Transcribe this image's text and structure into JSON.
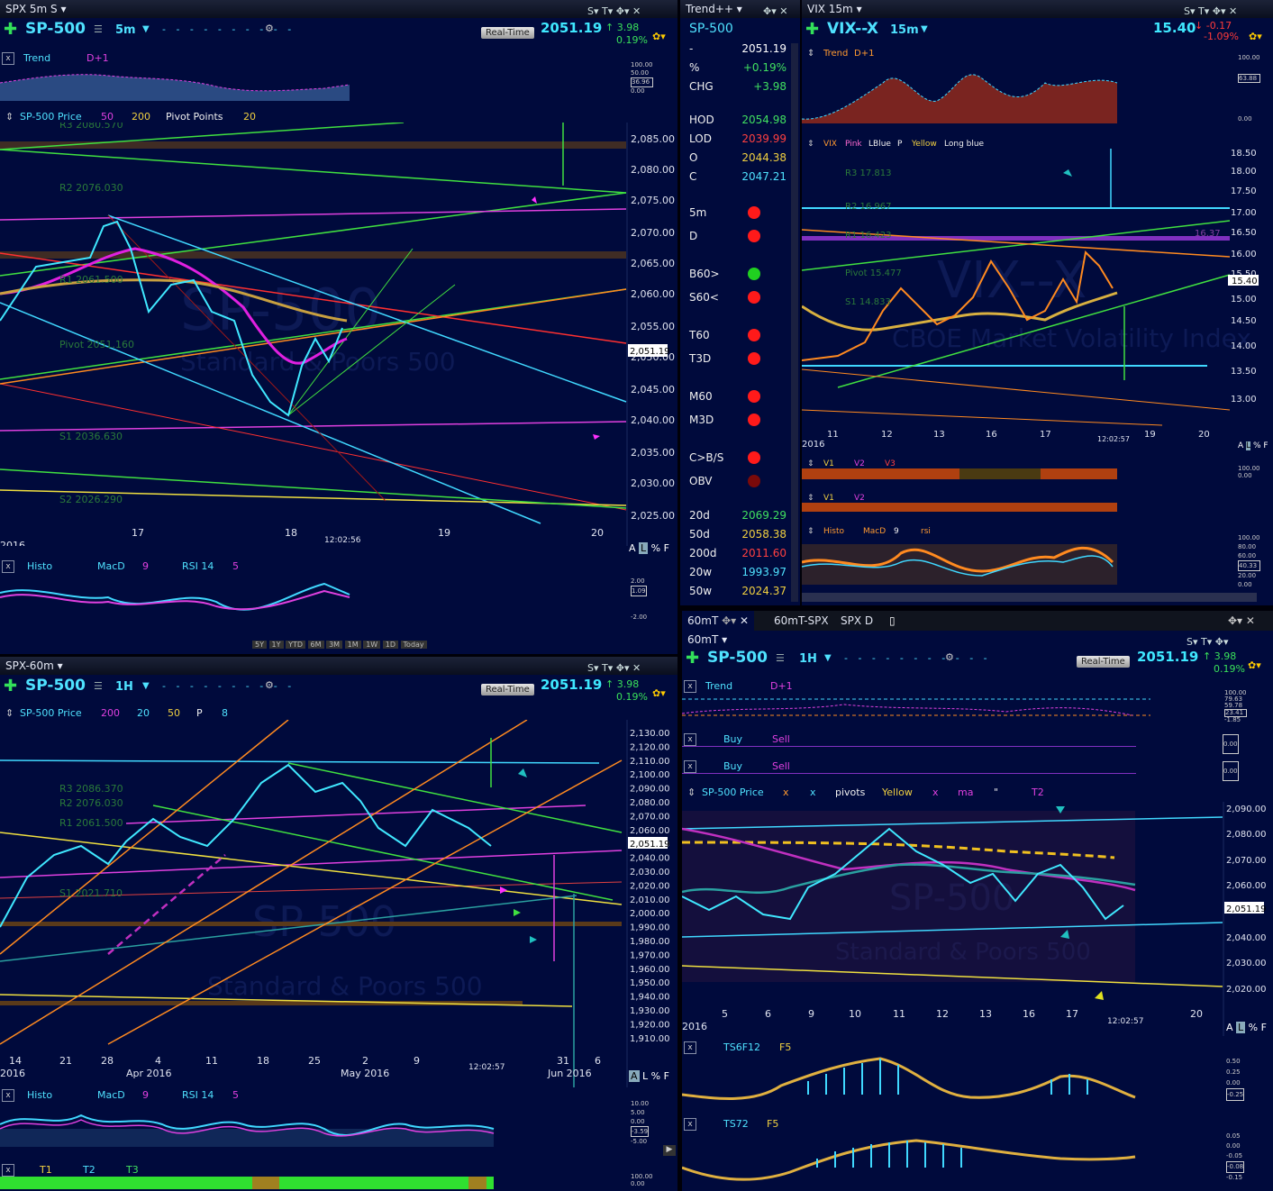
{
  "top_left": {
    "window_title": "SPX 5m S",
    "symbol": "SP-500",
    "timeframe": "5m",
    "realtime": "Real-Time",
    "last": "2051.19",
    "change": "3.98",
    "change_pct": "0.19%",
    "trend_label": "Trend",
    "trend_param": "D+1",
    "trend_scale": [
      "100.00",
      "50.00",
      "36.96",
      "0.00"
    ],
    "price_label": "SP-500 Price",
    "price_p1": "50",
    "price_p2": "200",
    "pivot_label": "Pivot Points",
    "pivot_p": "20",
    "price_axis": [
      "2,085.00",
      "2,080.00",
      "2,075.00",
      "2,070.00",
      "2,065.00",
      "2,060.00",
      "2,055.00",
      "2,050.00",
      "2,045.00",
      "2,040.00",
      "2,035.00",
      "2,030.00",
      "2,025.00"
    ],
    "last_tag": "2,051.19",
    "pivot_levels": [
      "R3 2080.570",
      "R2 2076.030",
      "R1 2061.500",
      "Pivot 2051.160",
      "S1 2036.630",
      "S2 2026.290"
    ],
    "x_labels": [
      "17",
      "18",
      "19",
      "20"
    ],
    "year": "2016",
    "time": "12:02:56",
    "axis_modes": [
      "A",
      "L",
      "%",
      "F"
    ],
    "watermark1": "SP-500",
    "watermark2": "Standard & Poors 500",
    "osc_label": "Histo",
    "osc_macd": "MacD",
    "osc_p1": "9",
    "osc_rsi": "RSI 14",
    "osc_p2": "5",
    "osc_scale": [
      "2.00",
      "1.09",
      "-2.00"
    ],
    "ranges": [
      "5Y",
      "1Y",
      "YTD",
      "6M",
      "3M",
      "1M",
      "1W",
      "1D",
      "Today"
    ]
  },
  "trend_panel": {
    "title": "Trend++",
    "symbol": "SP-500",
    "rows": [
      {
        "k": "-",
        "v": "2051.19",
        "c": "#ffffff"
      },
      {
        "k": "%",
        "v": "+0.19%",
        "c": "#40e060"
      },
      {
        "k": "CHG",
        "v": "+3.98",
        "c": "#40e060"
      },
      {
        "k": "HOD",
        "v": "2054.98",
        "c": "#40e060"
      },
      {
        "k": "LOD",
        "v": "2039.99",
        "c": "#ff4040"
      },
      {
        "k": "O",
        "v": "2044.38",
        "c": "#f0d040"
      },
      {
        "k": "C",
        "v": "2047.21",
        "c": "#4fe2ff"
      }
    ],
    "signals": [
      {
        "k": "5m",
        "c": "#ff1a1a"
      },
      {
        "k": "D",
        "c": "#ff1a1a"
      },
      {
        "k": "B60>",
        "c": "#20d020"
      },
      {
        "k": "S60<",
        "c": "#ff1a1a"
      },
      {
        "k": "T60",
        "c": "#ff1a1a"
      },
      {
        "k": "T3D",
        "c": "#ff1a1a"
      },
      {
        "k": "M60",
        "c": "#ff1a1a"
      },
      {
        "k": "M3D",
        "c": "#ff1a1a"
      },
      {
        "k": "C>B/S",
        "c": "#ff1a1a"
      },
      {
        "k": "OBV",
        "c": "#7a0a0a"
      }
    ],
    "mas": [
      {
        "k": "20d",
        "v": "2069.29",
        "c": "#40e060"
      },
      {
        "k": "50d",
        "v": "2058.38",
        "c": "#f0d040"
      },
      {
        "k": "200d",
        "v": "2011.60",
        "c": "#ff4040"
      },
      {
        "k": "20w",
        "v": "1993.97",
        "c": "#4fe2ff"
      },
      {
        "k": "50w",
        "v": "2024.37",
        "c": "#f0d040"
      }
    ]
  },
  "top_right": {
    "window_title": "VIX 15m",
    "symbol": "VIX--X",
    "timeframe": "15m",
    "last": "15.40",
    "change": "-0.17",
    "change_pct": "-1.09%",
    "trend_label": "Trend",
    "trend_param": "D+1",
    "trend_scale": [
      "100.00",
      "63.88",
      "0.00"
    ],
    "price_label": "VIX",
    "p_pink": "Pink",
    "p_lblue": "LBlue",
    "p_p": "P",
    "p_yellow": "Yellow",
    "p_longblue": "Long blue",
    "price_axis": [
      "18.50",
      "18.00",
      "17.50",
      "17.00",
      "16.50",
      "16.00",
      "15.50",
      "15.00",
      "14.50",
      "14.00",
      "13.50",
      "13.00"
    ],
    "last_tag": "15.40",
    "pivot_levels": [
      "R3 17.813",
      "R2 16.967",
      "R1 16.423",
      "Pivot 15.477",
      "S1 14.833"
    ],
    "right_level": "16.37",
    "x_labels": [
      "11",
      "12",
      "13",
      "16",
      "17",
      "19",
      "20"
    ],
    "year": "2016",
    "time": "12:02:57",
    "watermark1": "VIX--X",
    "watermark2": "CBOE Market Volatility Index",
    "axis_modes": [
      "A",
      "L",
      "%",
      "F"
    ],
    "v_row1": [
      "V1",
      "V2",
      "V3"
    ],
    "v_row2": [
      "V1",
      "V2"
    ],
    "v_scale": [
      "100.00",
      "0.00"
    ],
    "osc_label": "Histo",
    "osc_macd": "MacD",
    "osc_p1": "9",
    "osc_rsi": "rsi",
    "osc_scale": [
      "100.00",
      "80.00",
      "60.00",
      "40.33",
      "20.00",
      "0.00"
    ]
  },
  "bottom_left": {
    "window_title": "SPX-60m",
    "symbol": "SP-500",
    "timeframe": "1H",
    "realtime": "Real-Time",
    "last": "2051.19",
    "change": "3.98",
    "change_pct": "0.19%",
    "price_label": "SP-500 Price",
    "params": [
      "200",
      "20",
      "50",
      "P",
      "8"
    ],
    "price_axis": [
      "2,130.00",
      "2,120.00",
      "2,110.00",
      "2,100.00",
      "2,090.00",
      "2,080.00",
      "2,070.00",
      "2,060.00",
      "2,050.00",
      "2,040.00",
      "2,030.00",
      "2,020.00",
      "2,010.00",
      "2,000.00",
      "1,990.00",
      "1,980.00",
      "1,970.00",
      "1,960.00",
      "1,950.00",
      "1,940.00",
      "1,930.00",
      "1,920.00",
      "1,910.00"
    ],
    "last_tag": "2,051.19",
    "pivot_levels": [
      "R3 2086.370",
      "R2 2076.030",
      "R1 2061.500",
      "S1 2021.710"
    ],
    "x_labels": [
      "14",
      "21",
      "28",
      "4",
      "11",
      "18",
      "25",
      "2",
      "9",
      "31",
      "6"
    ],
    "month_labels": [
      "2016",
      "Apr 2016",
      "May 2016",
      "Jun 2016"
    ],
    "time": "12:02:57",
    "watermark1": "SP-500",
    "watermark2": "Standard & Poors 500",
    "axis_modes": [
      "A",
      "L",
      "%",
      "F"
    ],
    "osc_label": "Histo",
    "osc_macd": "MacD",
    "osc_p1": "9",
    "osc_rsi": "RSI 14",
    "osc_p2": "5",
    "osc_scale": [
      "10.00",
      "5.00",
      "0.00",
      "-5.00",
      "-3.59"
    ],
    "t_labels": [
      "T1",
      "T2",
      "T3"
    ],
    "t_scale": [
      "100.00",
      "0.00"
    ]
  },
  "tabs": [
    "60mT",
    "60mT-SPX",
    "SPX D"
  ],
  "bottom_right": {
    "window_title": "60mT",
    "symbol": "SP-500",
    "timeframe": "1H",
    "realtime": "Real-Time",
    "last": "2051.19",
    "change": "3.98",
    "change_pct": "0.19%",
    "trend_label": "Trend",
    "trend_param": "D+1",
    "trend_scale": [
      "100.00",
      "79.63",
      "59.78",
      "23.41",
      "-1.85"
    ],
    "buy": "Buy",
    "sell": "Sell",
    "zero": "0.00",
    "price_label": "SP-500 Price",
    "pp": [
      "x",
      "x",
      "pivots",
      "Yellow",
      "x",
      "ma",
      "\"",
      "T2"
    ],
    "price_axis": [
      "2,090.00",
      "2,080.00",
      "2,070.00",
      "2,060.00",
      "2,050.00",
      "2,040.00",
      "2,030.00",
      "2,020.00"
    ],
    "last_tag": "2,051.19",
    "x_labels": [
      "5",
      "6",
      "9",
      "10",
      "11",
      "12",
      "13",
      "16",
      "17",
      "20"
    ],
    "year": "2016",
    "time": "12:02:57",
    "watermark1": "SP-500",
    "watermark2": "Standard & Poors 500",
    "axis_modes": [
      "A",
      "L",
      "%",
      "F"
    ],
    "ts1_label": "TS6F12",
    "ts1_p": "F5",
    "ts1_scale": [
      "0.50",
      "0.25",
      "0.00",
      "-0.25"
    ],
    "ts2_label": "TS72",
    "ts2_p": "F5",
    "ts2_scale": [
      "0.05",
      "0.00",
      "-0.05",
      "-0.08",
      "-0.15"
    ]
  }
}
